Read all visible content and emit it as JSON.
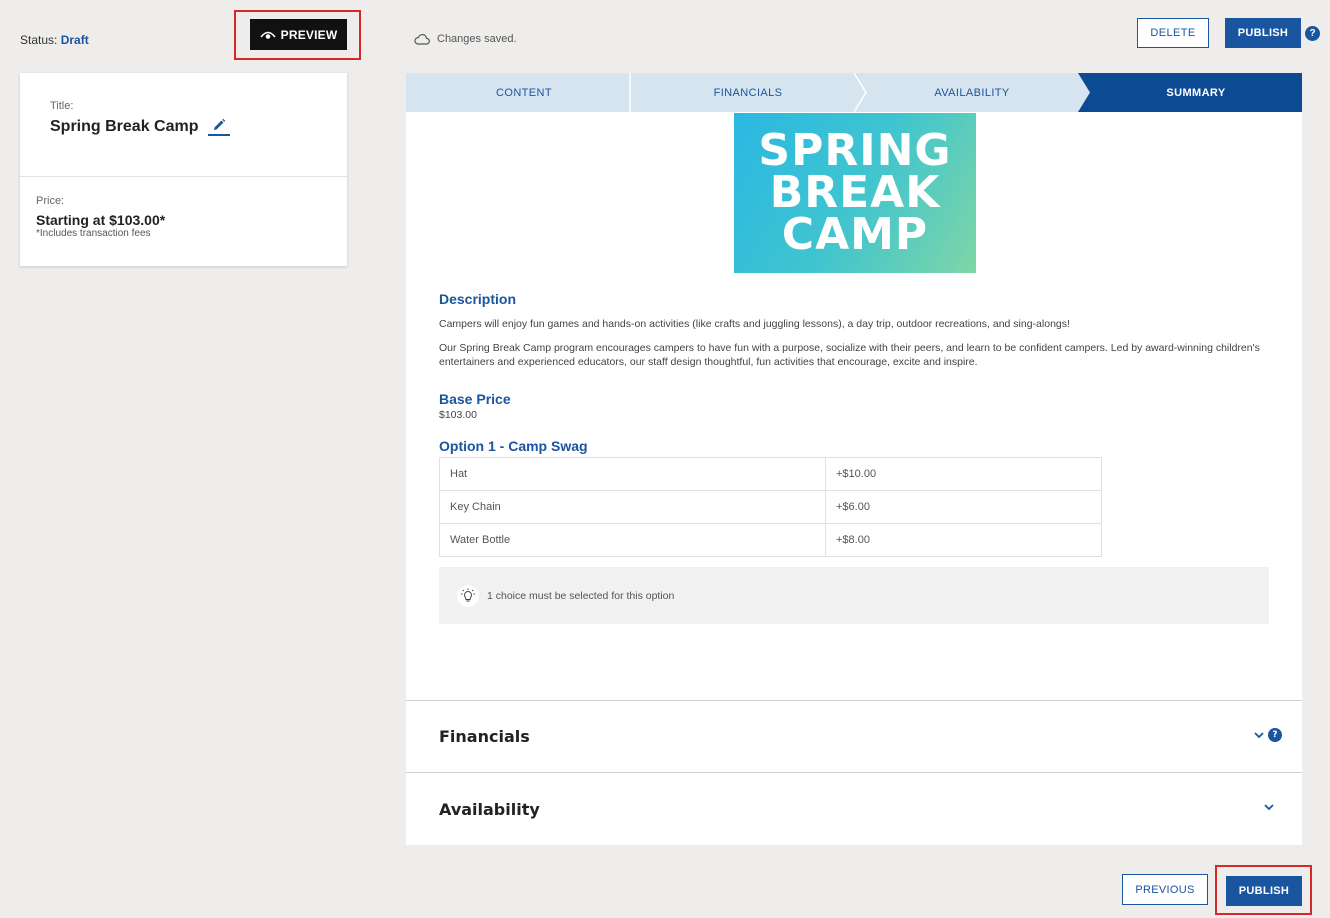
{
  "status": {
    "label": "Status:",
    "value": "Draft"
  },
  "preview_label": "PREVIEW",
  "card": {
    "title_label": "Title:",
    "title": "Spring Break Camp",
    "price_label": "Price:",
    "price": "Starting at $103.00*",
    "fees_note": "*Includes transaction fees"
  },
  "saved_text": "Changes saved.",
  "toolbar": {
    "delete_label": "DELETE",
    "publish_label": "PUBLISH",
    "help": "?"
  },
  "steps": [
    {
      "label": "CONTENT"
    },
    {
      "label": "FINANCIALS"
    },
    {
      "label": "AVAILABILITY"
    },
    {
      "label": "SUMMARY"
    }
  ],
  "hero": {
    "line1": "SPRING",
    "line2": "BREAK",
    "line3": "CAMP"
  },
  "description": {
    "heading": "Description",
    "p1": "Campers will enjoy fun games and hands-on activities (like crafts and juggling lessons), a day trip, outdoor recreations, and sing-alongs!",
    "p2": "Our Spring Break Camp program encourages campers to have fun with a purpose, socialize with their peers, and learn to be confident campers. Led by award-winning children's entertainers and experienced educators, our staff design thoughtful, fun activities that encourage, excite and inspire."
  },
  "base_price": {
    "heading": "Base Price",
    "value": "$103.00"
  },
  "option1": {
    "heading": "Option 1 - Camp Swag",
    "rows": [
      {
        "name": "Hat",
        "price": "+$10.00"
      },
      {
        "name": "Key Chain",
        "price": "+$6.00"
      },
      {
        "name": "Water Bottle",
        "price": "+$8.00"
      }
    ],
    "tip": "1 choice must be selected for this option"
  },
  "accordions": {
    "financials": "Financials",
    "availability": "Availability"
  },
  "bottom": {
    "previous_label": "PREVIOUS",
    "publish_label": "PUBLISH"
  },
  "colors": {
    "accent": "#1a55a0",
    "highlight": "#d62828",
    "step_bg": "#d6e4f0"
  }
}
